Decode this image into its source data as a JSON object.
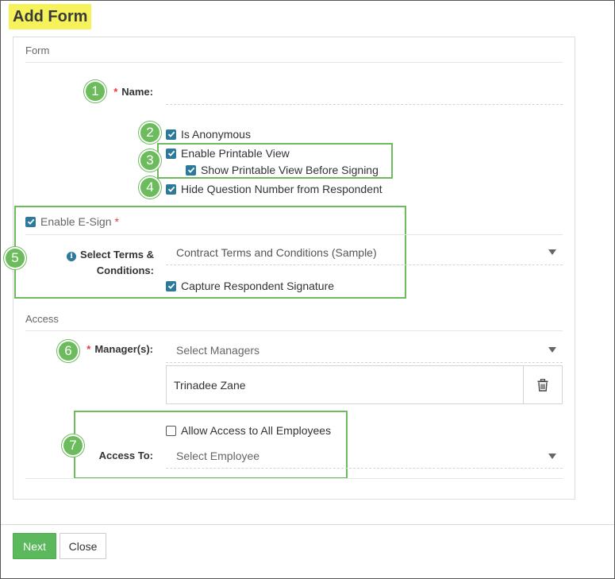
{
  "page": {
    "title": "Add Form"
  },
  "form_section": {
    "title": "Form",
    "name_label": "Name:",
    "name_value": "",
    "options": {
      "is_anonymous": {
        "label": "Is Anonymous",
        "checked": true
      },
      "enable_printable_view": {
        "label": "Enable Printable View",
        "checked": true
      },
      "show_printable_before_signing": {
        "label": "Show Printable View Before Signing",
        "checked": true
      },
      "hide_question_number": {
        "label": "Hide Question Number from Respondent",
        "checked": true
      }
    },
    "esign": {
      "label": "Enable E-Sign",
      "checked": true,
      "terms_label_line1": "Select Terms &",
      "terms_label_line2": "Conditions:",
      "terms_value": "Contract Terms and Conditions (Sample)",
      "capture_signature": {
        "label": "Capture Respondent Signature",
        "checked": true
      }
    }
  },
  "access_section": {
    "title": "Access",
    "managers_label": "Manager(s):",
    "managers_placeholder": "Select Managers",
    "managers": [
      "Trinadee Zane"
    ],
    "allow_all_employees": {
      "label": "Allow Access to All Employees",
      "checked": false
    },
    "access_to_label": "Access To:",
    "access_to_placeholder": "Select Employee"
  },
  "annotations": {
    "badges": [
      "1",
      "2",
      "3",
      "4",
      "5",
      "6",
      "7"
    ],
    "color": "#6cbb5c"
  },
  "footer": {
    "next_label": "Next",
    "close_label": "Close"
  },
  "colors": {
    "accent": "#2b7a9c",
    "title_highlight": "#f6f35a",
    "next_button": "#5cb85c",
    "required": "#e23a3a"
  },
  "icons": {
    "delete": "trash-icon",
    "info": "info-icon",
    "dropdown": "caret-down-icon",
    "checkbox": "checkmark-icon"
  }
}
